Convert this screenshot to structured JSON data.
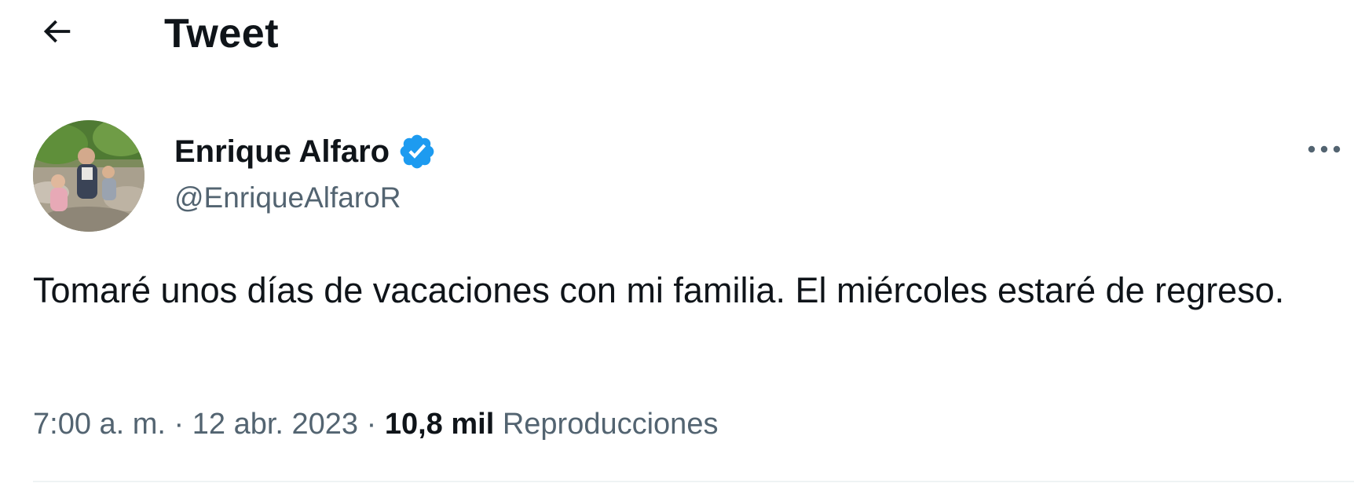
{
  "header": {
    "title": "Tweet",
    "back_icon": "arrow-left-icon"
  },
  "tweet": {
    "author": {
      "name": "Enrique Alfaro",
      "handle": "@EnriqueAlfaroR",
      "verified": true,
      "verified_color": "#1d9bf0",
      "avatar_icon": "avatar-photo"
    },
    "more_icon": "more-horizontal-icon",
    "text": "Tomaré unos días de vacaciones con mi familia. El miércoles estaré de regreso.",
    "time": "7:00 a. m.",
    "date": "12 abr. 2023",
    "separator": "·",
    "views_count": "10,8 mil",
    "views_label": "Reproducciones"
  },
  "colors": {
    "text_primary": "#0f1419",
    "text_secondary": "#536471",
    "divider": "#eff3f4",
    "verified": "#1d9bf0"
  }
}
